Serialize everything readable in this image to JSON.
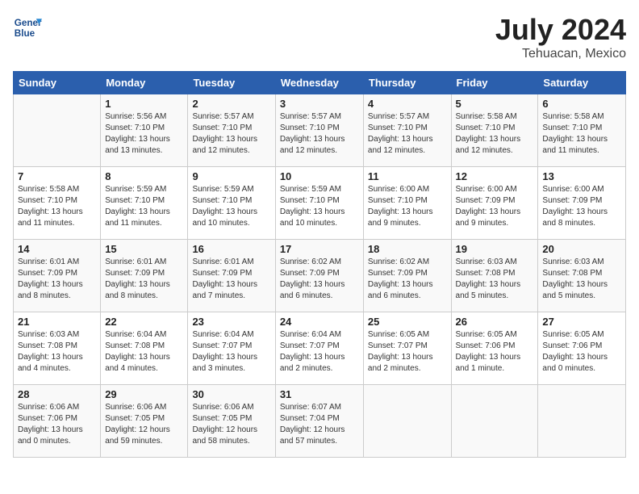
{
  "header": {
    "logo_line1": "General",
    "logo_line2": "Blue",
    "title": "July 2024",
    "subtitle": "Tehuacan, Mexico"
  },
  "days_of_week": [
    "Sunday",
    "Monday",
    "Tuesday",
    "Wednesday",
    "Thursday",
    "Friday",
    "Saturday"
  ],
  "weeks": [
    [
      {
        "day": "",
        "info": ""
      },
      {
        "day": "1",
        "info": "Sunrise: 5:56 AM\nSunset: 7:10 PM\nDaylight: 13 hours\nand 13 minutes."
      },
      {
        "day": "2",
        "info": "Sunrise: 5:57 AM\nSunset: 7:10 PM\nDaylight: 13 hours\nand 12 minutes."
      },
      {
        "day": "3",
        "info": "Sunrise: 5:57 AM\nSunset: 7:10 PM\nDaylight: 13 hours\nand 12 minutes."
      },
      {
        "day": "4",
        "info": "Sunrise: 5:57 AM\nSunset: 7:10 PM\nDaylight: 13 hours\nand 12 minutes."
      },
      {
        "day": "5",
        "info": "Sunrise: 5:58 AM\nSunset: 7:10 PM\nDaylight: 13 hours\nand 12 minutes."
      },
      {
        "day": "6",
        "info": "Sunrise: 5:58 AM\nSunset: 7:10 PM\nDaylight: 13 hours\nand 11 minutes."
      }
    ],
    [
      {
        "day": "7",
        "info": "Sunrise: 5:58 AM\nSunset: 7:10 PM\nDaylight: 13 hours\nand 11 minutes."
      },
      {
        "day": "8",
        "info": "Sunrise: 5:59 AM\nSunset: 7:10 PM\nDaylight: 13 hours\nand 11 minutes."
      },
      {
        "day": "9",
        "info": "Sunrise: 5:59 AM\nSunset: 7:10 PM\nDaylight: 13 hours\nand 10 minutes."
      },
      {
        "day": "10",
        "info": "Sunrise: 5:59 AM\nSunset: 7:10 PM\nDaylight: 13 hours\nand 10 minutes."
      },
      {
        "day": "11",
        "info": "Sunrise: 6:00 AM\nSunset: 7:10 PM\nDaylight: 13 hours\nand 9 minutes."
      },
      {
        "day": "12",
        "info": "Sunrise: 6:00 AM\nSunset: 7:09 PM\nDaylight: 13 hours\nand 9 minutes."
      },
      {
        "day": "13",
        "info": "Sunrise: 6:00 AM\nSunset: 7:09 PM\nDaylight: 13 hours\nand 8 minutes."
      }
    ],
    [
      {
        "day": "14",
        "info": "Sunrise: 6:01 AM\nSunset: 7:09 PM\nDaylight: 13 hours\nand 8 minutes."
      },
      {
        "day": "15",
        "info": "Sunrise: 6:01 AM\nSunset: 7:09 PM\nDaylight: 13 hours\nand 8 minutes."
      },
      {
        "day": "16",
        "info": "Sunrise: 6:01 AM\nSunset: 7:09 PM\nDaylight: 13 hours\nand 7 minutes."
      },
      {
        "day": "17",
        "info": "Sunrise: 6:02 AM\nSunset: 7:09 PM\nDaylight: 13 hours\nand 6 minutes."
      },
      {
        "day": "18",
        "info": "Sunrise: 6:02 AM\nSunset: 7:09 PM\nDaylight: 13 hours\nand 6 minutes."
      },
      {
        "day": "19",
        "info": "Sunrise: 6:03 AM\nSunset: 7:08 PM\nDaylight: 13 hours\nand 5 minutes."
      },
      {
        "day": "20",
        "info": "Sunrise: 6:03 AM\nSunset: 7:08 PM\nDaylight: 13 hours\nand 5 minutes."
      }
    ],
    [
      {
        "day": "21",
        "info": "Sunrise: 6:03 AM\nSunset: 7:08 PM\nDaylight: 13 hours\nand 4 minutes."
      },
      {
        "day": "22",
        "info": "Sunrise: 6:04 AM\nSunset: 7:08 PM\nDaylight: 13 hours\nand 4 minutes."
      },
      {
        "day": "23",
        "info": "Sunrise: 6:04 AM\nSunset: 7:07 PM\nDaylight: 13 hours\nand 3 minutes."
      },
      {
        "day": "24",
        "info": "Sunrise: 6:04 AM\nSunset: 7:07 PM\nDaylight: 13 hours\nand 2 minutes."
      },
      {
        "day": "25",
        "info": "Sunrise: 6:05 AM\nSunset: 7:07 PM\nDaylight: 13 hours\nand 2 minutes."
      },
      {
        "day": "26",
        "info": "Sunrise: 6:05 AM\nSunset: 7:06 PM\nDaylight: 13 hours\nand 1 minute."
      },
      {
        "day": "27",
        "info": "Sunrise: 6:05 AM\nSunset: 7:06 PM\nDaylight: 13 hours\nand 0 minutes."
      }
    ],
    [
      {
        "day": "28",
        "info": "Sunrise: 6:06 AM\nSunset: 7:06 PM\nDaylight: 13 hours\nand 0 minutes."
      },
      {
        "day": "29",
        "info": "Sunrise: 6:06 AM\nSunset: 7:05 PM\nDaylight: 12 hours\nand 59 minutes."
      },
      {
        "day": "30",
        "info": "Sunrise: 6:06 AM\nSunset: 7:05 PM\nDaylight: 12 hours\nand 58 minutes."
      },
      {
        "day": "31",
        "info": "Sunrise: 6:07 AM\nSunset: 7:04 PM\nDaylight: 12 hours\nand 57 minutes."
      },
      {
        "day": "",
        "info": ""
      },
      {
        "day": "",
        "info": ""
      },
      {
        "day": "",
        "info": ""
      }
    ]
  ]
}
